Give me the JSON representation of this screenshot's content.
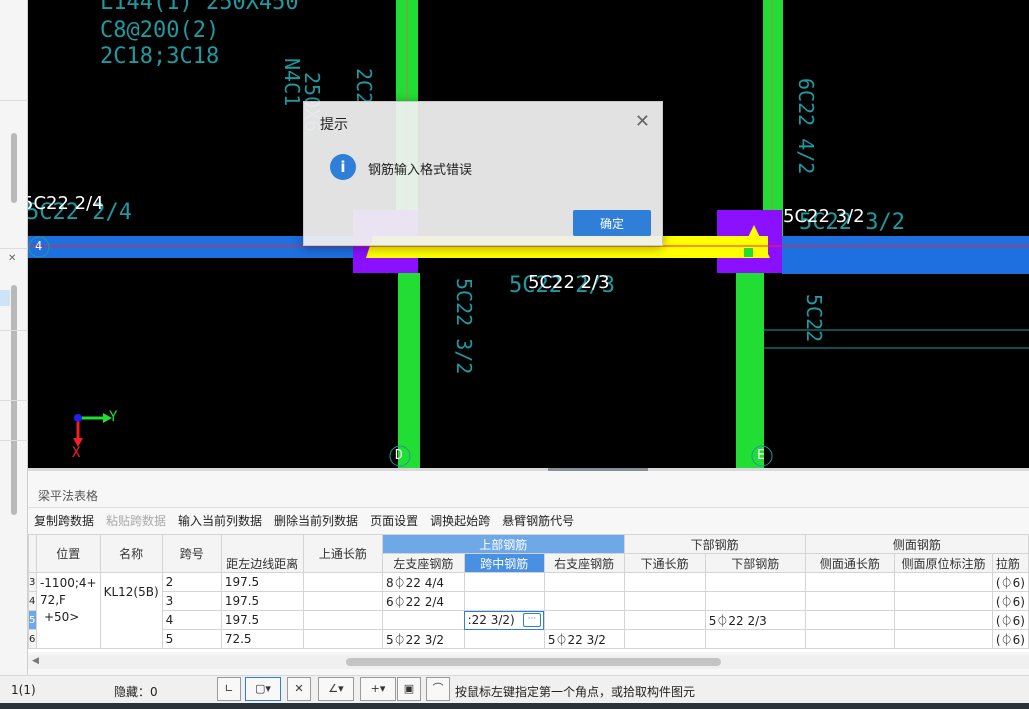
{
  "left_strip": {
    "close_glyph": "✕"
  },
  "canvas": {
    "texts_cyan": [
      "L144(1) 250X450",
      "C8@200(2)",
      "2C18;3C18",
      "250X6",
      "N4C1",
      "2C2",
      "6C22 4/2",
      "5C22 2/4",
      "5C22 3/2",
      "5C22 2/3",
      "5C22 3/2",
      "5C22"
    ],
    "texts_white": [
      "5C22 2/4",
      "5C22 3/2",
      "5C22 2/3"
    ],
    "axis_labels": {
      "grid_4": "4",
      "grid_d": "D",
      "grid_e": "E",
      "x": "X",
      "y": "Y"
    },
    "colors": {
      "column": "#22dd33",
      "beam": "#1e6fe0",
      "selected_beam": "#ffff00",
      "support": "#8a10ff",
      "text": "#1e9aa0",
      "red_line": "#ff2020",
      "annotation": "#ee2222"
    }
  },
  "dialog": {
    "title": "提示",
    "close": "✕",
    "icon": "info-icon",
    "icon_glyph": "i",
    "message": "钢筋输入格式错误",
    "ok_label": "确定"
  },
  "panel": {
    "title": "梁平法表格",
    "toolbar": [
      {
        "label": "复制跨数据",
        "enabled": true
      },
      {
        "label": "粘贴跨数据",
        "enabled": false
      },
      {
        "label": "输入当前列数据",
        "enabled": true
      },
      {
        "label": "删除当前列数据",
        "enabled": true
      },
      {
        "label": "页面设置",
        "enabled": true
      },
      {
        "label": "调换起始跨",
        "enabled": true
      },
      {
        "label": "悬臂钢筋代号",
        "enabled": true
      }
    ],
    "headers": {
      "position": "位置",
      "name": "名称",
      "span_no": "跨号",
      "dist_left": "距左边线距离",
      "top_through": "上通长筋",
      "top_rebar_group": "上部钢筋",
      "left_support": "左支座钢筋",
      "mid_span": "跨中钢筋",
      "right_support": "右支座钢筋",
      "bottom_rebar_group": "下部钢筋",
      "bottom_through": "下通长筋",
      "bottom_rebar": "下部钢筋",
      "side_rebar_group": "侧面钢筋",
      "side_through": "侧面通长筋",
      "side_original": "侧面原位标注筋",
      "tie": "拉筋"
    },
    "position_text": [
      "-1100;4+",
      "72,F",
      "+50>"
    ],
    "beam_name": "KL12(5B)",
    "rows": [
      {
        "row_no": "3",
        "span": "2",
        "dist": "197.5",
        "top_through": "",
        "left_support": "8⏀22 4/4",
        "mid_span": "",
        "right_support": "",
        "bottom_through": "",
        "bottom": "",
        "side_through": "",
        "side_original": "",
        "tie": "(⏀6)"
      },
      {
        "row_no": "4",
        "span": "3",
        "dist": "197.5",
        "top_through": "",
        "left_support": "6⏀22 2/4",
        "mid_span": "",
        "right_support": "",
        "bottom_through": "",
        "bottom": "",
        "side_through": "",
        "side_original": "",
        "tie": "(⏀6)"
      },
      {
        "row_no": "5",
        "span": "4",
        "dist": "197.5",
        "top_through": "",
        "left_support": "",
        "mid_span": ":22 3/2)",
        "right_support": "",
        "bottom_through": "",
        "bottom": "5⏀22 2/3",
        "side_through": "",
        "side_original": "",
        "tie": "(⏀6)"
      },
      {
        "row_no": "6",
        "span": "5",
        "dist": "72.5",
        "top_through": "",
        "left_support": "5⏀22 3/2",
        "mid_span": "",
        "right_support": "5⏀22 3/2",
        "bottom_through": "",
        "bottom": "",
        "side_through": "",
        "side_original": "",
        "tie": "(⏀6)"
      }
    ],
    "cell_button": "···",
    "scroll_left": "◀"
  },
  "status": {
    "count": "1(1)",
    "hidden": "隐藏：0",
    "message": "按鼠标左键指定第一个角点，或拾取构件图元"
  }
}
